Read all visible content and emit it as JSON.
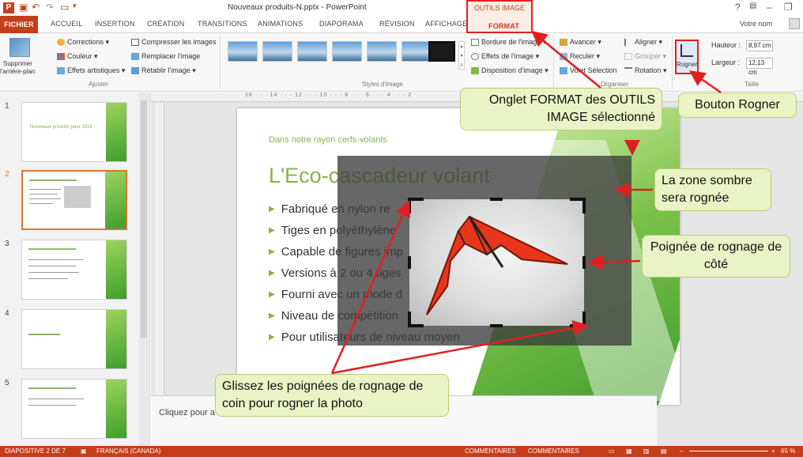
{
  "window": {
    "doc_title": "Nouveaux produits-N.pptx - PowerPoint",
    "help": "?",
    "minimize": "–",
    "restore": "❐",
    "user": "Votre nom"
  },
  "context_group": {
    "label": "OUTILS IMAGE"
  },
  "tabs": [
    {
      "label": "FICHIER"
    },
    {
      "label": "ACCUEIL"
    },
    {
      "label": "INSERTION"
    },
    {
      "label": "CRÉATION"
    },
    {
      "label": "TRANSITIONS"
    },
    {
      "label": "ANIMATIONS"
    },
    {
      "label": "DIAPORAMA"
    },
    {
      "label": "RÉVISION"
    },
    {
      "label": "AFFICHAGE"
    },
    {
      "label": "FORMAT"
    }
  ],
  "ribbon": {
    "adjust": {
      "remove_bg": "Supprimer",
      "remove_bg2": "l'arrière-plan",
      "corrections": "Corrections ▾",
      "color": "Couleur ▾",
      "artistic": "Effets artistiques ▾",
      "compress": "Compresser les images",
      "replace": "Remplacer l'image",
      "reset": "Rétablir l'image ▾",
      "group_label": "Ajuster"
    },
    "styles": {
      "group_label": "Styles d'image",
      "border": "Bordure de l'image ▾",
      "effects": "Effets de l'image ▾",
      "layout": "Disposition d'image ▾"
    },
    "arrange": {
      "forward": "Avancer ▾",
      "backward": "Reculer ▾",
      "selection": "Volet Sélection",
      "align": "Aligner ▾",
      "group": "Grouper ▾",
      "rotate": "Rotation ▾",
      "group_label": "Organiser"
    },
    "size": {
      "crop": "Rogner",
      "height_label": "Hauteur :",
      "height_value": "8,97 cm",
      "width_label": "Largeur :",
      "width_value": "12,13 cm",
      "group_label": "Taille"
    }
  },
  "ruler": "16 · · · 14 · · · 12 · · · 10 · · · 8 · · · 6 · · · 4 · · · 2",
  "thumbnails": [
    {
      "num": "1",
      "heading": "Nouveaux produits pour 2016"
    },
    {
      "num": "2"
    },
    {
      "num": "3"
    },
    {
      "num": "4"
    },
    {
      "num": "5"
    }
  ],
  "slide": {
    "subtitle": "Dans notre rayon cerfs-volants",
    "title": "L'Eco-cascadeur volant",
    "bullets": [
      "Fabriqué en nylon re",
      "Tiges en polyéthylène",
      "Capable de figures imp",
      "Versions à 2 ou 4 tiges",
      "Fourni avec un mode d",
      "Niveau de compétition",
      "Pour utilisateurs de niveau moyen"
    ]
  },
  "notes": {
    "placeholder": "Cliquez pour a"
  },
  "callouts": {
    "format_tab": "Onglet FORMAT des OUTILS IMAGE sélectionné",
    "crop_button": "Bouton Rogner",
    "dark_zone": "La zone sombre sera rognée",
    "side_handle": "Poignée de rognage de côté",
    "corner_handles": "Glissez les poignées de rognage de coin pour rogner la photo"
  },
  "status": {
    "slide": "DIAPOSITIVE 2 DE 7",
    "lang": "FRANÇAIS (CANADA)",
    "notes": "COMMENTAIRES",
    "comments": "COMMENTAIRES",
    "zoom": "65 %"
  },
  "colors": {
    "accent": "#c43e1c",
    "highlight": "#e02020",
    "slide_green": "#7fb84a",
    "callout_bg": "#eaf3c6"
  }
}
